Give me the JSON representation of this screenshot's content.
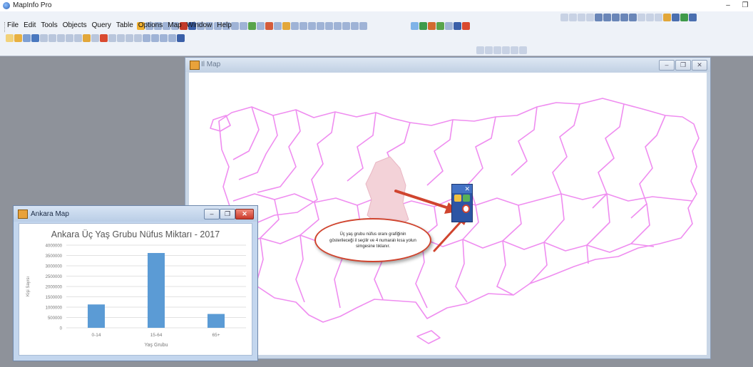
{
  "app": {
    "title": "MapInfo Pro",
    "minimize": "–",
    "restore": "❐"
  },
  "menu": [
    "File",
    "Edit",
    "Tools",
    "Objects",
    "Query",
    "Table",
    "Options",
    "Map",
    "Window",
    "Help"
  ],
  "il_map_window": {
    "title": "Il Map",
    "minimize": "–",
    "restore": "❐",
    "close": "✕"
  },
  "ankara_window": {
    "title": "Ankara Map",
    "minimize": "–",
    "restore": "❐",
    "close": "✕"
  },
  "palette": {
    "close": "✕"
  },
  "callout": {
    "text": "Üç yaş grubu nüfus oranı grafiğinin gösterileceği il seçilir ve 4 numaralı kısa yolun simgesine tıklanır."
  },
  "colors": {
    "province_border": "#ef8df0",
    "selected_fill": "#f3d2d8",
    "bar": "#5b9bd5",
    "arrow": "#d0442e"
  },
  "chart_data": {
    "type": "bar",
    "title": "Ankara Üç Yaş Grubu Nüfus Miktarı - 2017",
    "xlabel": "Yaş Grubu",
    "ylabel": "Kişi Sayısı",
    "categories": [
      "0-14",
      "15-64",
      "65+"
    ],
    "values": [
      1130000,
      3620000,
      670000
    ],
    "ylim": [
      0,
      4000000
    ],
    "yticks": [
      "0",
      "500000",
      "1000000",
      "1500000",
      "2000000",
      "2500000",
      "3000000",
      "3500000",
      "4000000"
    ],
    "grid": true,
    "legend": "none"
  }
}
